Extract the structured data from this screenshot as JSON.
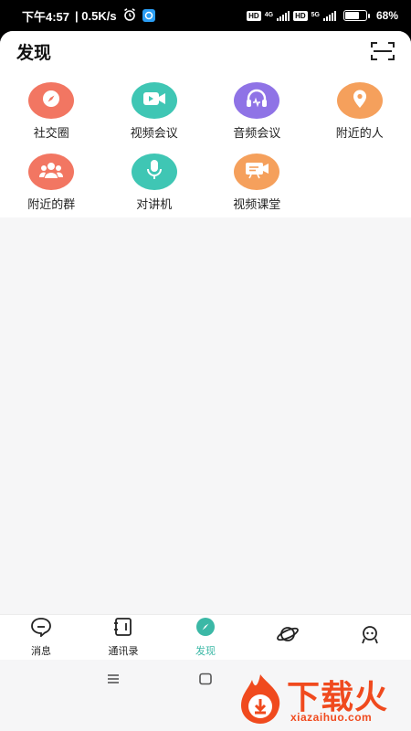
{
  "status_bar": {
    "time": "下午4:57",
    "speed": "| 0.5K/s",
    "hd1": "HD",
    "net1": "4G",
    "hd2": "HD",
    "net2": "5G",
    "battery_percent": "68%",
    "battery_level": 0.68
  },
  "header": {
    "title": "发现"
  },
  "grid": [
    {
      "label": "社交圈",
      "icon": "compass-icon",
      "color": "#f27662"
    },
    {
      "label": "视频会议",
      "icon": "video-camera-icon",
      "color": "#3fc6b4"
    },
    {
      "label": "音频会议",
      "icon": "headphones-icon",
      "color": "#8f73e6"
    },
    {
      "label": "附近的人",
      "icon": "location-pin-icon",
      "color": "#f5a05c"
    },
    {
      "label": "附近的群",
      "icon": "group-icon",
      "color": "#f27662"
    },
    {
      "label": "对讲机",
      "icon": "microphone-icon",
      "color": "#3fc6b4"
    },
    {
      "label": "视频课堂",
      "icon": "classroom-icon",
      "color": "#f5a05c"
    }
  ],
  "bottom_nav": [
    {
      "label": "消息",
      "icon": "chat-bubble-icon",
      "active": false
    },
    {
      "label": "通讯录",
      "icon": "contacts-icon",
      "active": false
    },
    {
      "label": "发现",
      "icon": "discover-icon",
      "active": true
    },
    {
      "label": "",
      "icon": "planet-icon",
      "active": false
    },
    {
      "label": "",
      "icon": "profile-icon",
      "active": false
    }
  ],
  "accent_color": "#3bb8a6",
  "watermark": {
    "title": "下载火",
    "site": "xiazaihuo.com"
  }
}
